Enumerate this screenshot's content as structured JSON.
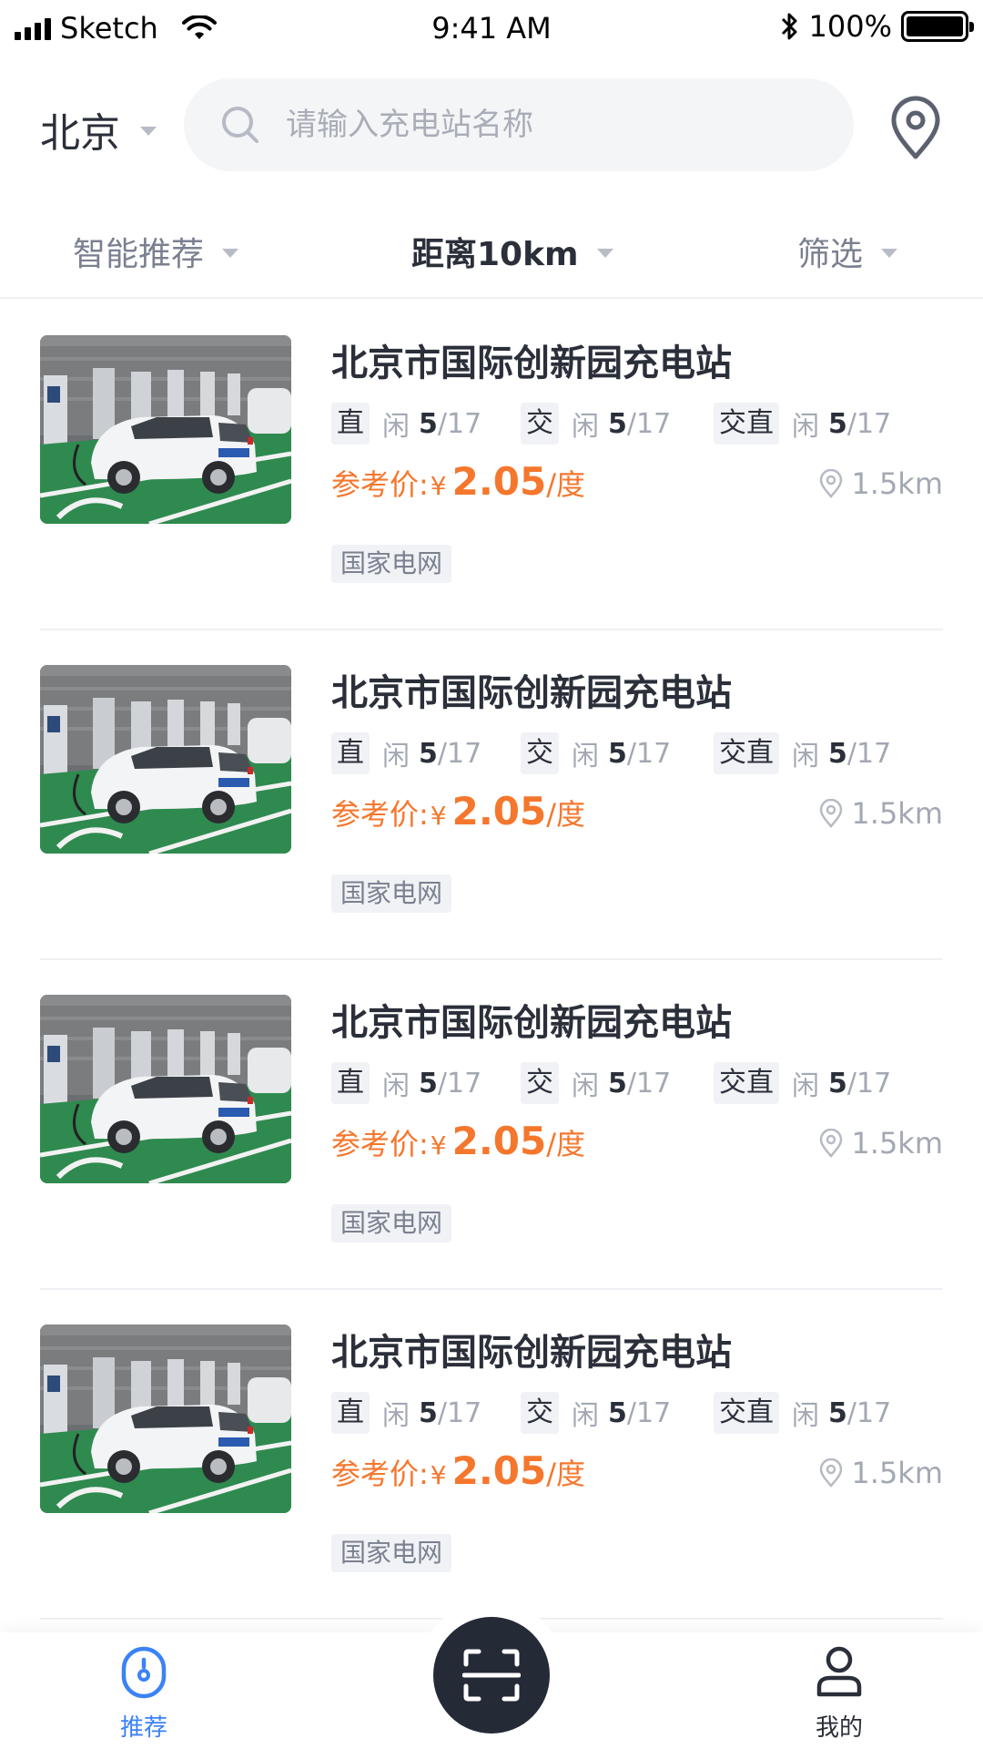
{
  "status_bar": {
    "carrier": "Sketch",
    "time": "9:41 AM",
    "battery": "100%"
  },
  "header": {
    "city": "北京",
    "search_placeholder": "请输入充电站名称"
  },
  "filters": [
    {
      "label": "智能推荐",
      "active": false
    },
    {
      "label": "距离10km",
      "active": true
    },
    {
      "label": "筛选",
      "active": false
    }
  ],
  "stations": [
    {
      "name": "北京市国际创新园充电站",
      "ports": [
        {
          "type": "直",
          "idle_label": "闲",
          "free": "5",
          "total": "/17"
        },
        {
          "type": "交",
          "idle_label": "闲",
          "free": "5",
          "total": "/17"
        },
        {
          "type": "交直",
          "idle_label": "闲",
          "free": "5",
          "total": "/17"
        }
      ],
      "price_label": "参考价:",
      "currency": "¥",
      "price": "2.05",
      "unit": "/度",
      "distance": "1.5km",
      "operator": "国家电网"
    },
    {
      "name": "北京市国际创新园充电站",
      "ports": [
        {
          "type": "直",
          "idle_label": "闲",
          "free": "5",
          "total": "/17"
        },
        {
          "type": "交",
          "idle_label": "闲",
          "free": "5",
          "total": "/17"
        },
        {
          "type": "交直",
          "idle_label": "闲",
          "free": "5",
          "total": "/17"
        }
      ],
      "price_label": "参考价:",
      "currency": "¥",
      "price": "2.05",
      "unit": "/度",
      "distance": "1.5km",
      "operator": "国家电网"
    },
    {
      "name": "北京市国际创新园充电站",
      "ports": [
        {
          "type": "直",
          "idle_label": "闲",
          "free": "5",
          "total": "/17"
        },
        {
          "type": "交",
          "idle_label": "闲",
          "free": "5",
          "total": "/17"
        },
        {
          "type": "交直",
          "idle_label": "闲",
          "free": "5",
          "total": "/17"
        }
      ],
      "price_label": "参考价:",
      "currency": "¥",
      "price": "2.05",
      "unit": "/度",
      "distance": "1.5km",
      "operator": "国家电网"
    },
    {
      "name": "北京市国际创新园充电站",
      "ports": [
        {
          "type": "直",
          "idle_label": "闲",
          "free": "5",
          "total": "/17"
        },
        {
          "type": "交",
          "idle_label": "闲",
          "free": "5",
          "total": "/17"
        },
        {
          "type": "交直",
          "idle_label": "闲",
          "free": "5",
          "total": "/17"
        }
      ],
      "price_label": "参考价:",
      "currency": "¥",
      "price": "2.05",
      "unit": "/度",
      "distance": "1.5km",
      "operator": "国家电网"
    }
  ],
  "tabbar": {
    "home": {
      "label": "推荐",
      "icon": "recommend-icon"
    },
    "scan": {
      "icon": "scan-icon"
    },
    "mine": {
      "label": "我的",
      "icon": "profile-icon"
    }
  },
  "colors": {
    "accent": "#f5772d",
    "tab_active": "#3b82f6",
    "scan_bg": "#252a37"
  }
}
